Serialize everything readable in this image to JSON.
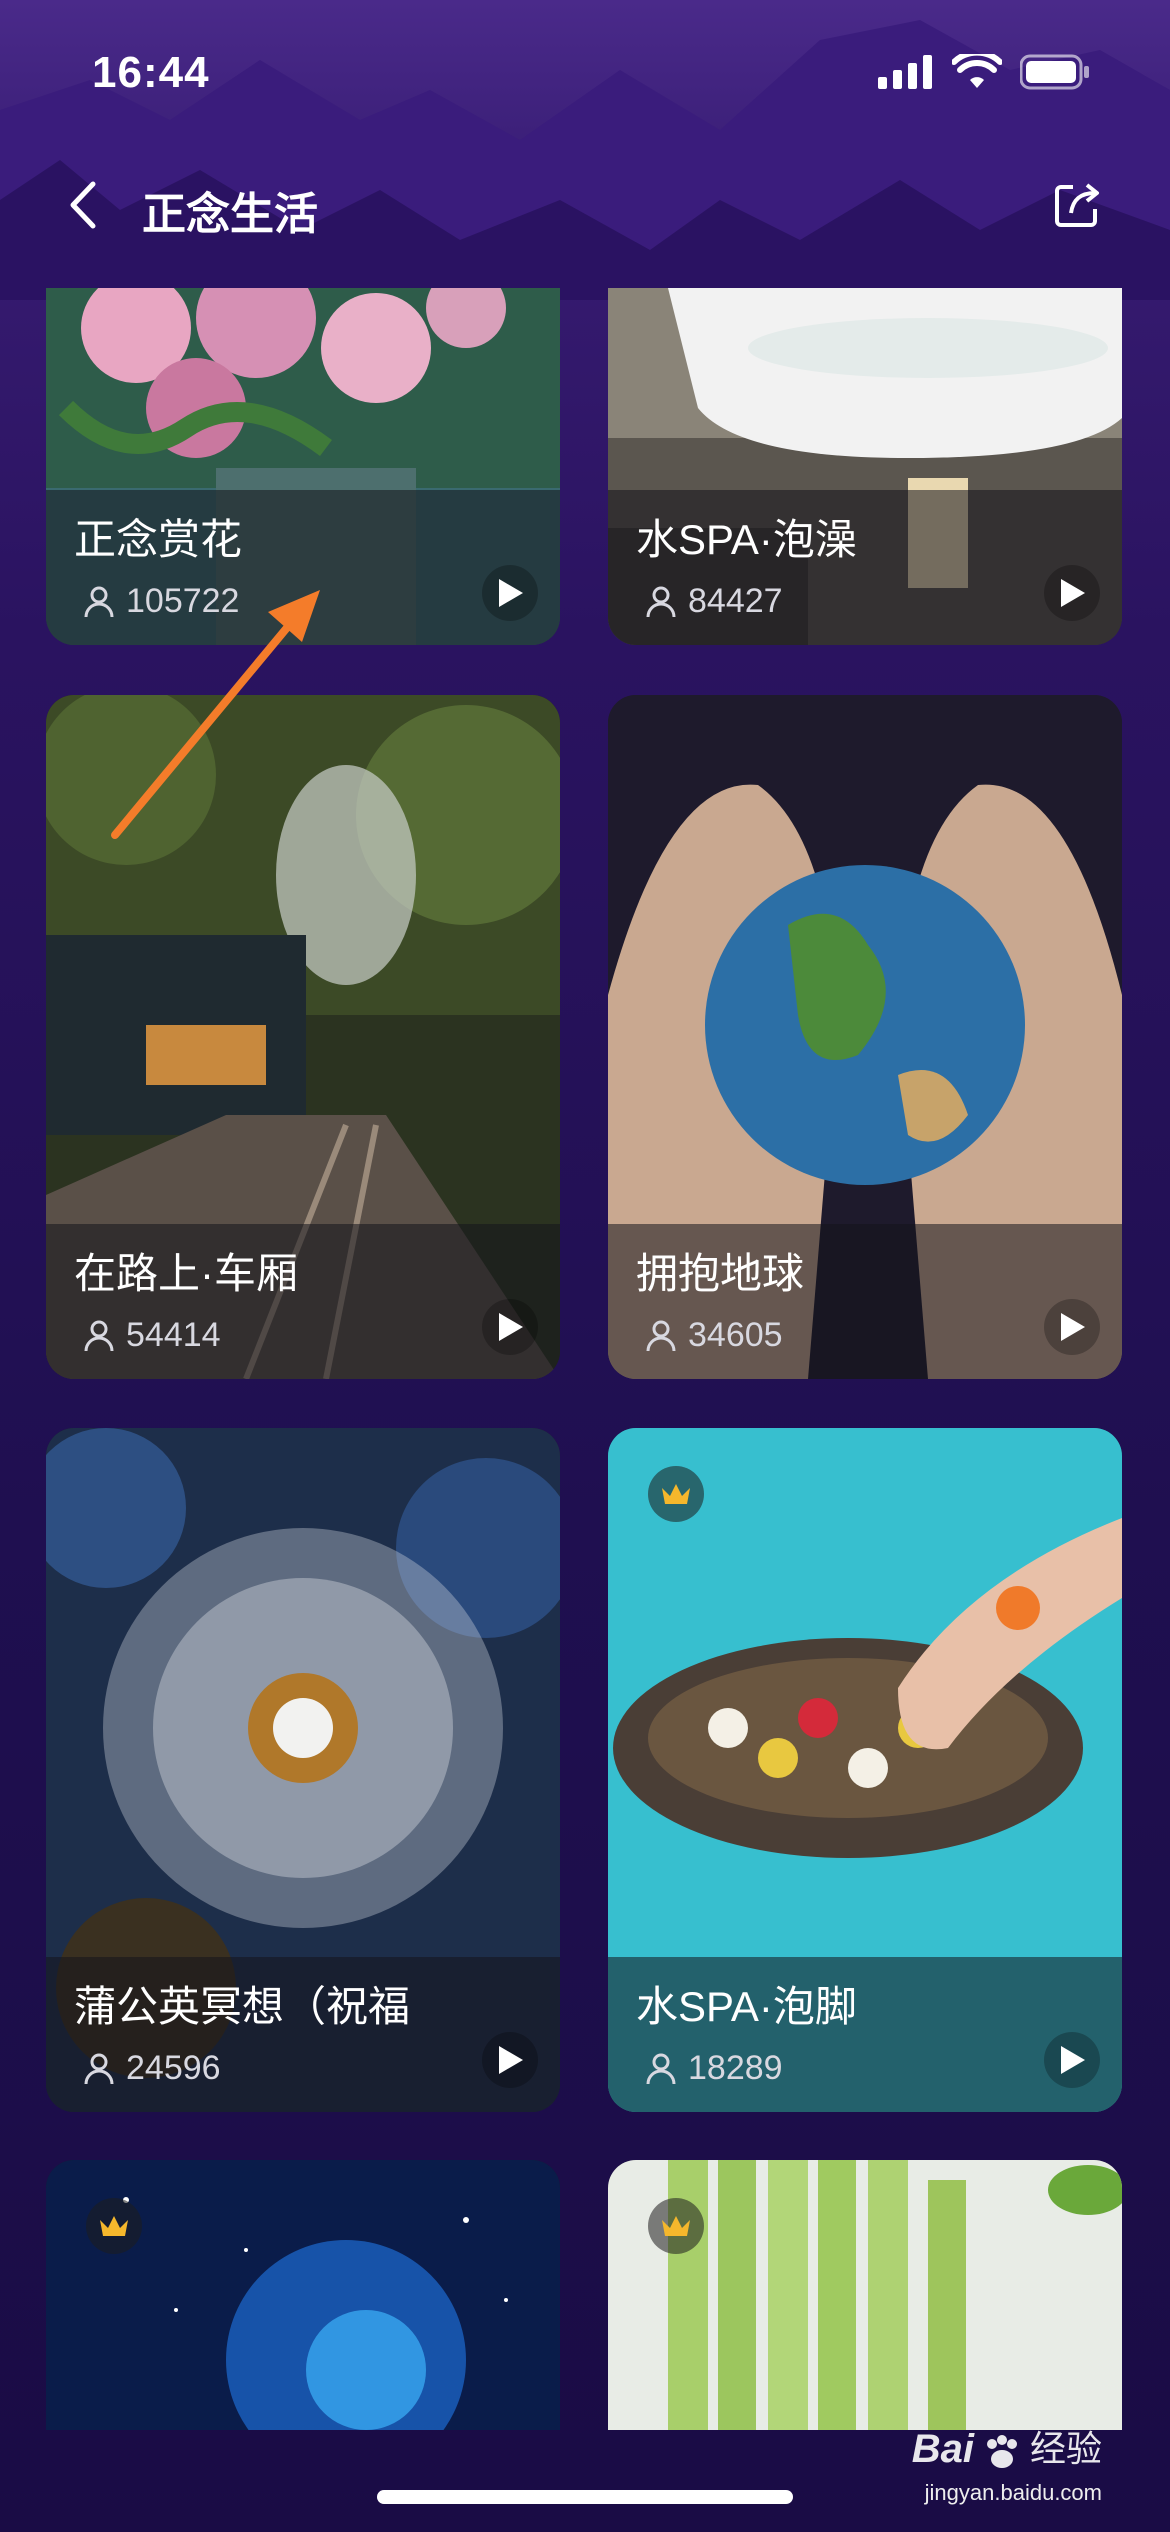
{
  "status_bar": {
    "time": "16:44"
  },
  "nav": {
    "title": "正念生活"
  },
  "cards": [
    {
      "title": "正念赏花",
      "count": "105722",
      "premium": false
    },
    {
      "title": "水SPA·泡澡",
      "count": "84427",
      "premium": false
    },
    {
      "title": "在路上·车厢",
      "count": "54414",
      "premium": false
    },
    {
      "title": "拥抱地球",
      "count": "34605",
      "premium": false
    },
    {
      "title": "蒲公英冥想（祝福",
      "count": "24596",
      "premium": false
    },
    {
      "title": "水SPA·泡脚",
      "count": "18289",
      "premium": true
    },
    {
      "title": "",
      "count": "",
      "premium": true
    },
    {
      "title": "",
      "count": "",
      "premium": true
    }
  ],
  "watermark": {
    "brand": "Bai",
    "brand2": "经验",
    "url": "jingyan.baidu.com"
  },
  "colors": {
    "background": "#2a1360",
    "arrow": "#f47c2a"
  }
}
